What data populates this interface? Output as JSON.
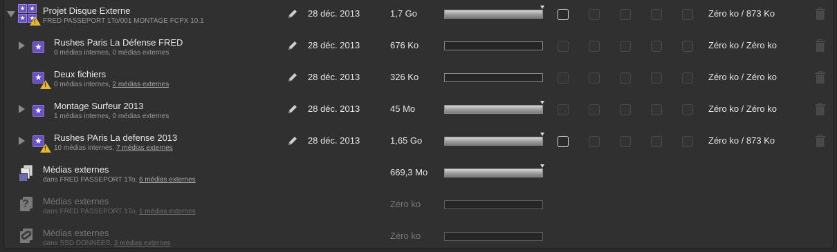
{
  "rows": [
    {
      "title": "Projet Disque Externe",
      "subtitle": "FRED PASSEPORT 1To/001 MONTAGE FCPX 10.1",
      "date": "28 déc. 2013",
      "size": "1,7 Go",
      "usage": "Zéro ko / 873 Ko",
      "bar_fill": 1.0
    },
    {
      "title": "Rushes Paris La Défense FRED",
      "subtitle": "0 médias internes, 0 médias externes",
      "date": "28 déc. 2013",
      "size": "676 Ko",
      "usage": "Zéro ko / Zéro ko",
      "bar_fill": 0.0
    },
    {
      "title": "Deux fichiers",
      "subtitle_a": "0 médias internes, ",
      "subtitle_link": "2 médias externes",
      "date": "28 déc. 2013",
      "size": "326 Ko",
      "usage": "Zéro ko / Zéro ko",
      "bar_fill": 0.0
    },
    {
      "title": "Montage Surfeur 2013",
      "subtitle": "1 médias internes, 0 médias externes",
      "date": "28 déc. 2013",
      "size": "45 Mo",
      "usage": "Zéro ko / Zéro ko",
      "bar_fill": 1.0
    },
    {
      "title": "Rushes PAris La defense 2013",
      "subtitle_a": "10 médias internes, ",
      "subtitle_link": "7 médias externes",
      "date": "28 déc. 2013",
      "size": "1,65 Go",
      "usage": "Zéro ko / 873 Ko",
      "bar_fill": 1.0
    },
    {
      "title": "Médias externes",
      "subtitle_a": "dans FRED PASSEPORT 1To, ",
      "subtitle_link": "6 médias externes",
      "size": "669,3 Mo",
      "bar_fill": 1.0
    },
    {
      "title": "Médias externes",
      "subtitle_a": "dans FRED PASSEPORT 1To, ",
      "subtitle_link": "1 médias externes",
      "size": "Zéro ko",
      "bar_fill": 0.0
    },
    {
      "title": "Médias externes",
      "subtitle_a": "dans SSD DONNEES, ",
      "subtitle_link": "2 médias externes",
      "size": "Zéro ko",
      "bar_fill": 0.0
    }
  ],
  "icons": {
    "library": "library-icon",
    "event": "event-star-icon",
    "warning": "warning-icon",
    "media": "external-media-icon",
    "missing": "missing-media-icon",
    "link": "linked-media-icon",
    "edit": "pencil-icon",
    "delete": "trash-icon"
  },
  "colors": {
    "event_purple": "#6a4fc0",
    "warning_yellow": "#e8b92a",
    "background": "#303030"
  }
}
